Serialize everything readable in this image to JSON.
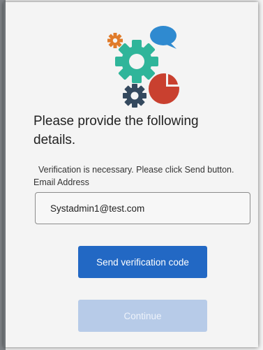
{
  "form": {
    "heading": "Please provide the following details.",
    "info_text": "Verification is necessary. Please click Send button.",
    "email_label": "Email Address",
    "email_value": "Systadmin1@test.com",
    "send_button_label": "Send verification code",
    "continue_button_label": "Continue",
    "continue_enabled": false
  },
  "logo": {
    "icons": [
      "gear-icon-small",
      "speech-bubble-icon",
      "gear-icon-large",
      "pie-chart-icon",
      "gear-icon-dark"
    ]
  },
  "colors": {
    "primary_button": "#2268c4",
    "disabled_button": "#b7cbe8",
    "orange_gear": "#e07b2a",
    "teal_gear": "#2fb59a",
    "blue_bubble": "#2f8ad0",
    "red_pie": "#c9402f",
    "dark_gear": "#34495e"
  }
}
